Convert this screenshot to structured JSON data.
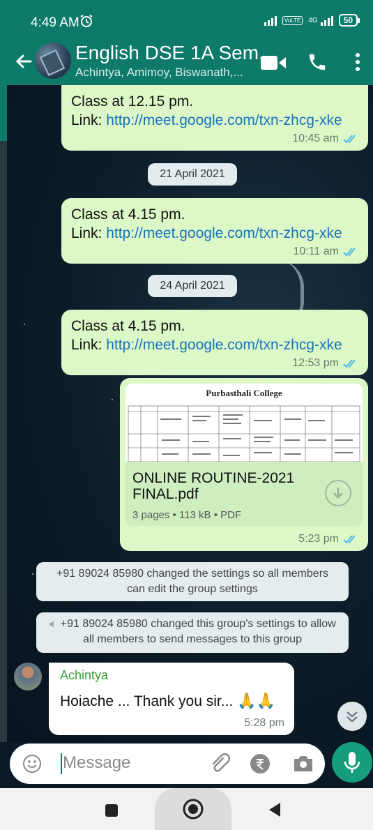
{
  "status_bar": {
    "time": "4:49 AM",
    "battery": "50",
    "network": "4G",
    "volte": "VoLTE"
  },
  "header": {
    "title": "English DSE 1A Sem...",
    "subtitle": "Achintya, Amimoy, Biswanath,..."
  },
  "messages": [
    {
      "type": "outgoing_text",
      "line1": "Class at 12.15 pm.",
      "link_prefix": "Link: ",
      "link": "http://meet.google.com/txn-zhcg-xke",
      "time": "10:45 am"
    },
    {
      "type": "date",
      "text": "21 April 2021"
    },
    {
      "type": "outgoing_text",
      "line1": "Class at 4.15 pm.",
      "link_prefix": "Link: ",
      "link": "http://meet.google.com/txn-zhcg-xke",
      "time": "10:11 am"
    },
    {
      "type": "date",
      "text": "24 April 2021"
    },
    {
      "type": "outgoing_text",
      "line1": "Class at 4.15 pm.",
      "link_prefix": "Link: ",
      "link": "http://meet.google.com/txn-zhcg-xke",
      "time": "12:53 pm"
    },
    {
      "type": "outgoing_document",
      "preview_title": "Purbasthali College",
      "filename": "ONLINE ROUTINE-2021 FINAL.pdf",
      "details": "3 pages • 113 kB • PDF",
      "time": "5:23 pm"
    },
    {
      "type": "system",
      "text": "+91 89024 85980 changed the settings so all members can edit the group settings"
    },
    {
      "type": "system",
      "text": "+91 89024 85980 changed this group's settings to allow all members to send messages to this group"
    },
    {
      "type": "incoming_text",
      "sender": "Achintya",
      "text": "Hoiache ...  Thank you sir...",
      "emoji": "🙏🙏",
      "time": "5:28 pm"
    }
  ],
  "input": {
    "placeholder": "Message"
  },
  "colors": {
    "header": "#0e7a6a",
    "outgoing_bubble": "#dcf8c6",
    "incoming_bubble": "#ffffff",
    "link": "#1a73b8",
    "read_tick": "#4fb6ec",
    "sender_name": "#3a9c3a",
    "mic_button": "#159e7c"
  },
  "icons": [
    "back-arrow-icon",
    "video-call-icon",
    "voice-call-icon",
    "more-options-icon",
    "emoji-icon",
    "attach-icon",
    "rupee-payment-icon",
    "camera-icon",
    "mic-icon",
    "scroll-down-icon",
    "download-icon",
    "double-tick-icon",
    "muted-icon",
    "nav-recents-icon",
    "nav-home-icon",
    "nav-back-icon"
  ]
}
